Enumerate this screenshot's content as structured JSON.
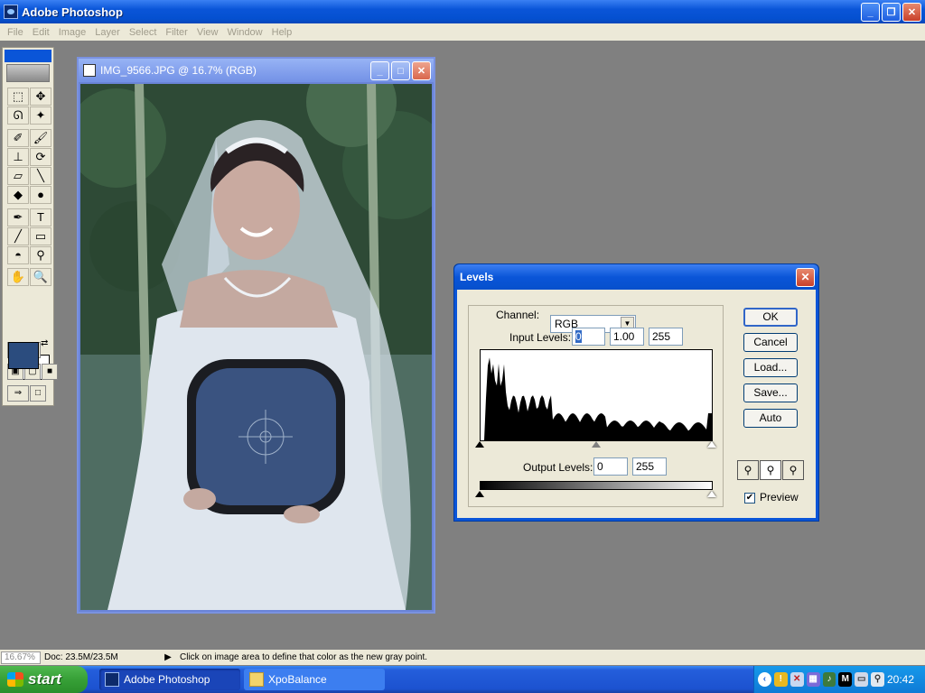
{
  "app": {
    "title": "Adobe Photoshop",
    "minimize": "_",
    "maximize": "❐",
    "close": "✕"
  },
  "menu": [
    "File",
    "Edit",
    "Image",
    "Layer",
    "Select",
    "Filter",
    "View",
    "Window",
    "Help"
  ],
  "document": {
    "title": "IMG_9566.JPG @ 16.7% (RGB)"
  },
  "levels": {
    "title": "Levels",
    "close": "✕",
    "channel_label": "Channel:",
    "channel_value": "RGB",
    "input_label": "Input Levels:",
    "input_black": "0",
    "input_gamma": "1.00",
    "input_white": "255",
    "output_label": "Output Levels:",
    "output_black": "0",
    "output_white": "255",
    "buttons": {
      "ok": "OK",
      "cancel": "Cancel",
      "load": "Load...",
      "save": "Save...",
      "auto": "Auto"
    },
    "preview_label": "Preview",
    "preview_checked": true
  },
  "statusbar": {
    "zoom": "16.67%",
    "doc_size": "Doc: 23.5M/23.5M",
    "message": "Click on image area to define that color as the new gray point."
  },
  "taskbar": {
    "start": "start",
    "tasks": [
      "Adobe Photoshop",
      "XpoBalance"
    ],
    "clock": "20:42"
  },
  "colors": {
    "foreground": "#2b4c7e",
    "background": "#ffffff",
    "xp_blue": "#0a55d8"
  }
}
